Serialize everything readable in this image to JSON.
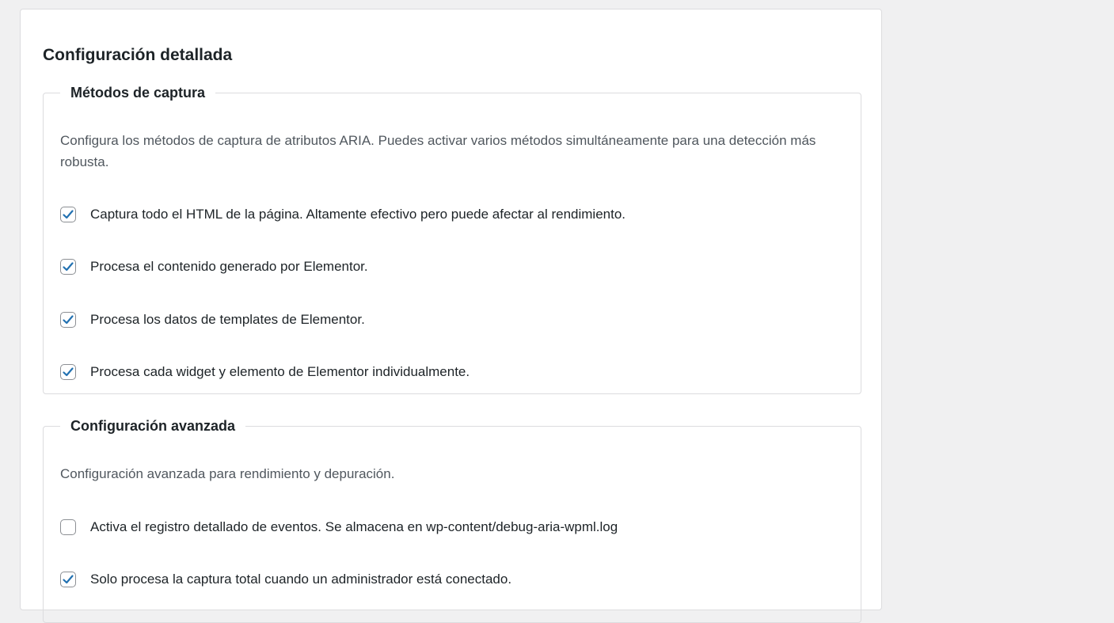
{
  "page": {
    "title": "Configuración detallada"
  },
  "sections": [
    {
      "title": "Métodos de captura",
      "description": "Configura los métodos de captura de atributos ARIA. Puedes activar varios métodos simultáneamente para una detección más robusta.",
      "options": [
        {
          "label": "Captura todo el HTML de la página. Altamente efectivo pero puede afectar al rendimiento.",
          "checked": true
        },
        {
          "label": "Procesa el contenido generado por Elementor.",
          "checked": true
        },
        {
          "label": "Procesa los datos de templates de Elementor.",
          "checked": true
        },
        {
          "label": "Procesa cada widget y elemento de Elementor individualmente.",
          "checked": true
        }
      ]
    },
    {
      "title": "Configuración avanzada",
      "description": "Configuración avanzada para rendimiento y depuración.",
      "options": [
        {
          "label": "Activa el registro detallado de eventos. Se almacena en wp-content/debug-aria-wpml.log",
          "checked": false
        },
        {
          "label": "Solo procesa la captura total cuando un administrador está conectado.",
          "checked": true
        }
      ]
    }
  ],
  "colors": {
    "accent": "#2271b1",
    "background": "#f0f0f1",
    "card": "#ffffff",
    "border": "#dcdcde",
    "text": "#1d2327",
    "muted_text": "#50575e"
  },
  "icons": {
    "checked": "checkmark-icon"
  }
}
